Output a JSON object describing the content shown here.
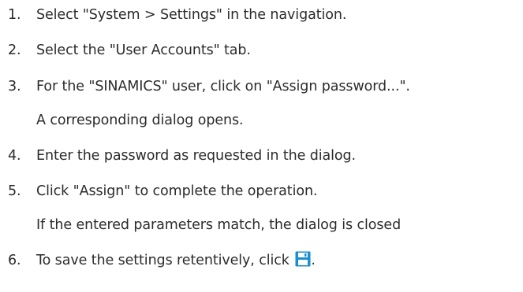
{
  "steps": [
    {
      "number": "1.",
      "text": "Select \"System > Settings\" in the navigation."
    },
    {
      "number": "2.",
      "text": "Select the \"User Accounts\" tab."
    },
    {
      "number": "3.",
      "text": "For the \"SINAMICS\" user, click on \"Assign password...\".",
      "result": "A corresponding dialog opens."
    },
    {
      "number": "4.",
      "text": "Enter the password as requested in the dialog."
    },
    {
      "number": "5.",
      "text": "Click \"Assign\" to complete the operation.",
      "result": "If the entered parameters match, the dialog is closed"
    },
    {
      "number": "6.",
      "text": "To save the settings retentively, click",
      "text_after_icon": ".",
      "icon": "save-icon"
    }
  ],
  "colors": {
    "text": "#2b2b2b",
    "icon": "#1a8fd0"
  }
}
